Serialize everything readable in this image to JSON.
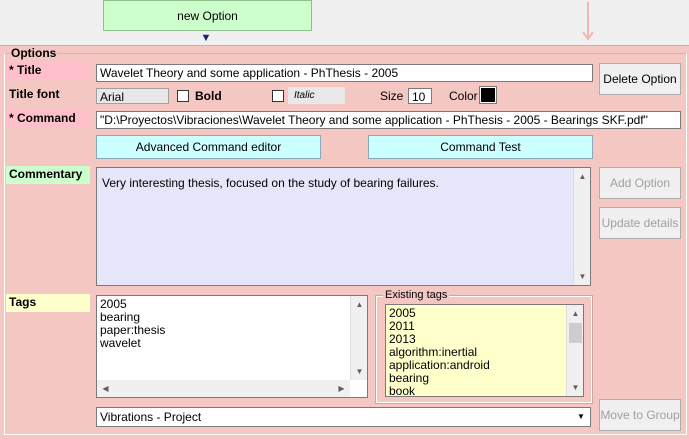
{
  "toolbar": {
    "new_option_label": "new Option",
    "down_arrow": "▼"
  },
  "options": {
    "group_label": "Options",
    "title_label": "* Title",
    "title_value": "Wavelet Theory and some application - PhThesis - 2005",
    "title_font_label": "Title font",
    "font_name": "Arial",
    "bold_label": "Bold",
    "italic_label": "Italic",
    "size_label": "Size",
    "size_value": "10",
    "color_label": "Color",
    "color_value": "#000000",
    "command_label": "* Command",
    "command_value": "\"D:\\Proyectos\\Vibraciones\\Wavelet Theory and some application - PhThesis - 2005 - Bearings SKF.pdf\"",
    "advanced_command_label": "Advanced Command editor",
    "command_test_label": "Command Test",
    "commentary_label": "Commentary",
    "commentary_value": "Very interesting thesis, focused on the study of bearing failures.",
    "tags_label": "Tags",
    "tags": [
      "2005",
      "bearing",
      "paper:thesis",
      "wavelet"
    ],
    "existing_tags_label": "Existing tags",
    "existing_tags": [
      "2005",
      "2011",
      "2013",
      "algorithm:inertial",
      "application:android",
      "bearing",
      "book"
    ],
    "group_select_value": "Vibrations - Project"
  },
  "buttons": {
    "delete_option": "Delete Option",
    "add_option": "Add Option",
    "update_details": "Update details",
    "move_to_group": "Move to Group"
  },
  "colors": {
    "panel": "#f4c7c3",
    "commentary_bg": "#e6e6fa",
    "existing_tags_bg": "#ffffcc"
  }
}
